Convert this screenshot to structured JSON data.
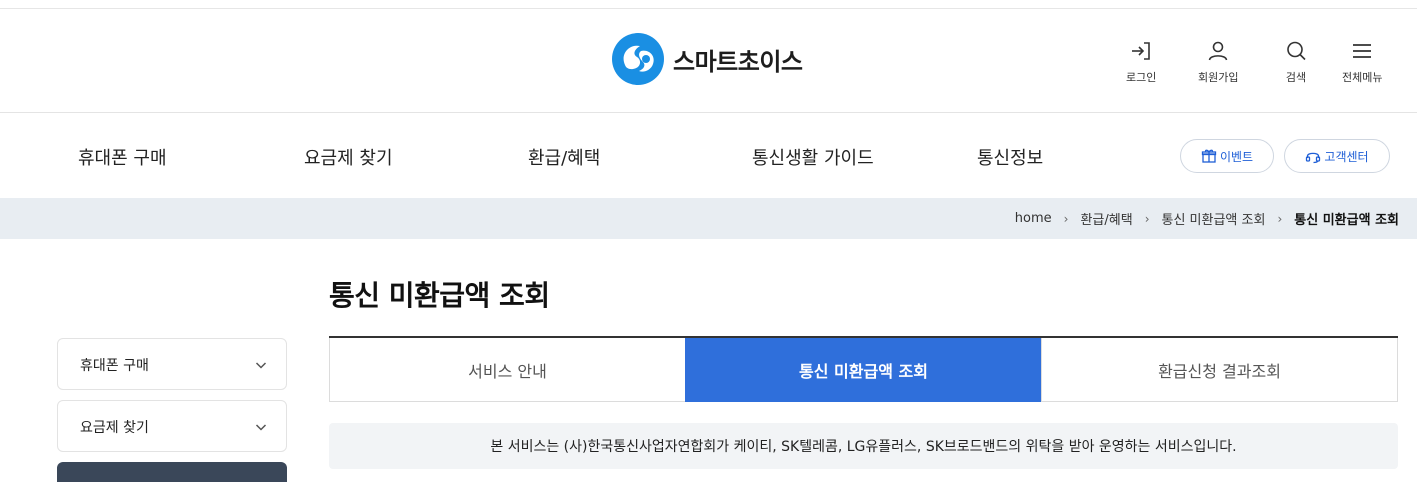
{
  "brand": {
    "name": "스마트초이스",
    "colors": {
      "primary": "#2f6fdb",
      "logo_blue": "#1a8fe3",
      "dark": "#3a4759"
    }
  },
  "utility": [
    {
      "label": "로그인",
      "icon": "login-icon"
    },
    {
      "label": "회원가입",
      "icon": "person-icon"
    },
    {
      "label": "검색",
      "icon": "search-icon"
    },
    {
      "label": "전체메뉴",
      "icon": "hamburger-icon"
    }
  ],
  "gnb": {
    "items": [
      "휴대폰 구매",
      "요금제 찾기",
      "환급/혜택",
      "통신생활 가이드",
      "통신정보"
    ],
    "event_label": "이벤트",
    "cs_label": "고객센터"
  },
  "breadcrumb": {
    "items": [
      "home",
      "환급/혜택",
      "통신 미환급액 조회",
      "통신 미환급액 조회"
    ]
  },
  "page": {
    "title": "통신 미환급액 조회"
  },
  "side_menu": {
    "items": [
      "휴대폰 구매",
      "요금제 찾기"
    ]
  },
  "tabs": {
    "items": [
      "서비스 안내",
      "통신 미환급액 조회",
      "환급신청 결과조회"
    ],
    "active_index": 1
  },
  "notice": {
    "text": "본 서비스는 (사)한국통신사업자연합회가 케이티, SK텔레콤, LG유플러스, SK브로드밴드의 위탁을 받아 운영하는 서비스입니다."
  }
}
